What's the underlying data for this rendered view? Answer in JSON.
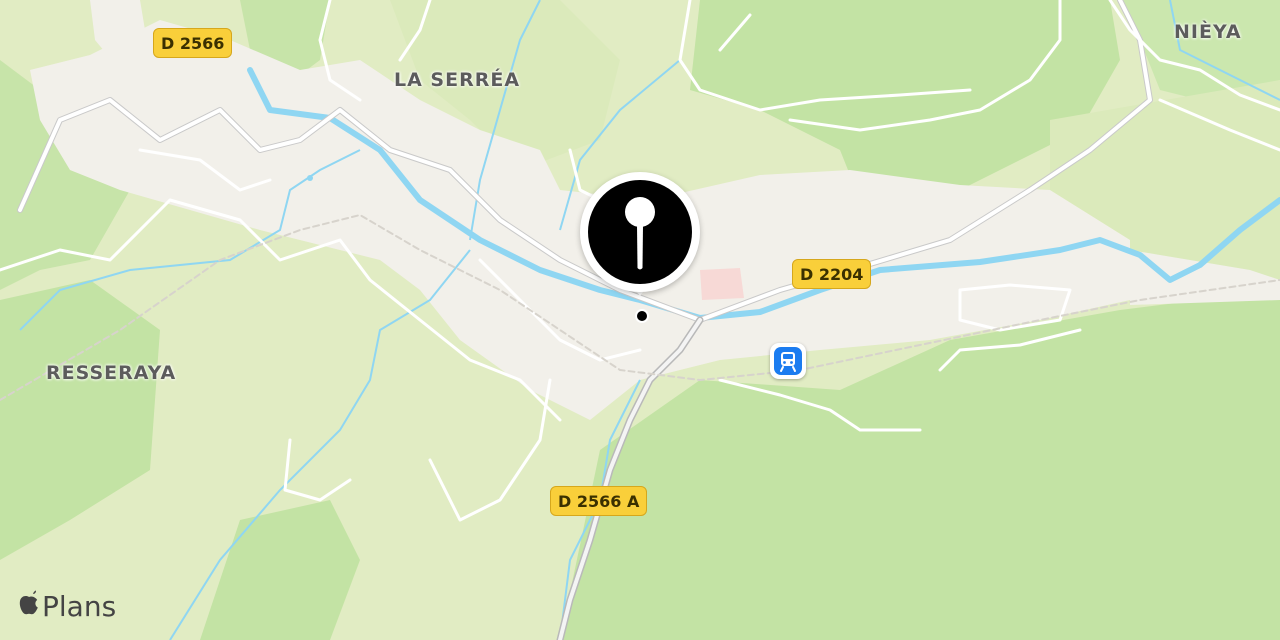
{
  "map": {
    "places": [
      {
        "id": "la-serrea",
        "name": "LA SERRÉA"
      },
      {
        "id": "nieya",
        "name": "NIÈYA"
      },
      {
        "id": "resseraya",
        "name": "RESSERAYA"
      }
    ],
    "roads": [
      {
        "id": "d2566",
        "label": "D 2566"
      },
      {
        "id": "d2204",
        "label": "D 2204"
      },
      {
        "id": "d2566a",
        "label": "D 2566 A"
      }
    ],
    "marker": {
      "icon": "map-pin-icon"
    },
    "poi": {
      "icon": "train-station-icon",
      "color": "#1b7cf0"
    }
  },
  "attribution": {
    "icon": "apple-logo-icon",
    "text": "Plans"
  },
  "colors": {
    "forest": "#c3e3a4",
    "meadow": "#e1ecc3",
    "urban": "#f2f0ea",
    "river": "#8fd6f2",
    "road": "#ffffff",
    "shield": "#f9cf3a"
  }
}
